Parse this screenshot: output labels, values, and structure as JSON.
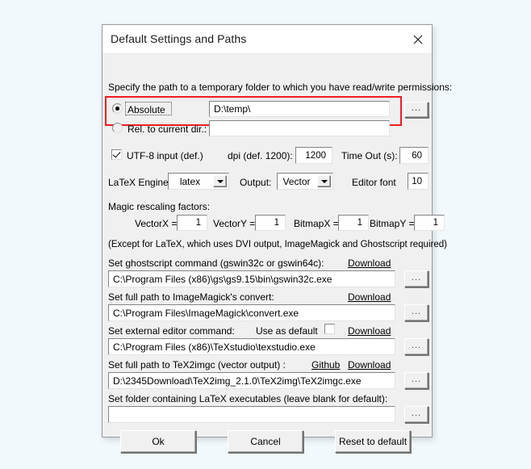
{
  "window": {
    "title": "Default Settings and Paths",
    "close_icon": "close-icon"
  },
  "temp_folder": {
    "instruction": "Specify the path to a temporary folder to which you have read/write permissions:",
    "absolute_label": "Absolute",
    "absolute_selected": true,
    "absolute_value": "D:\\temp\\",
    "absolute_browse": "...",
    "relative_label": "Rel. to current dir.: .\\",
    "relative_selected": false,
    "relative_value": "",
    "highlight_color": "#ee1c25"
  },
  "options": {
    "utf8_label": "UTF-8 input (def.)",
    "utf8_checked": true,
    "dpi_label": "dpi (def. 1200):",
    "dpi_value": "1200",
    "timeout_label": "Time Out (s):",
    "timeout_value": "60",
    "engine_label": "LaTeX Engine:",
    "engine_value": "latex",
    "engine_options": [
      "latex"
    ],
    "output_label": "Output:",
    "output_value": "Vector",
    "output_options": [
      "Vector"
    ],
    "editor_font_label": "Editor font",
    "editor_font_value": "10"
  },
  "rescaling": {
    "heading": "Magic rescaling factors:",
    "fields": [
      {
        "label": "VectorX =",
        "value": "1"
      },
      {
        "label": "VectorY =",
        "value": "1"
      },
      {
        "label": "BitmapX =",
        "value": "1"
      },
      {
        "label": "BitmapY =",
        "value": "1"
      }
    ],
    "note": "(Except for LaTeX, which uses DVI output, ImageMagick and Ghostscript required)"
  },
  "paths": {
    "ghostscript": {
      "label": "Set ghostscript command (gswin32c or gswin64c):",
      "download_link": "Download",
      "value": "C:\\Program Files (x86)\\gs\\gs9.15\\bin\\gswin32c.exe",
      "browse": "..."
    },
    "imagemagick": {
      "label": "Set full path to ImageMagick's convert:",
      "download_link": "Download",
      "value": "C:\\Program Files\\ImageMagick\\convert.exe",
      "browse": "..."
    },
    "editor": {
      "label": "Set external editor command:",
      "use_as_default_label": "Use as default",
      "use_as_default_checked": false,
      "download_link": "Download",
      "value": "C:\\Program Files (x86)\\TeXstudio\\texstudio.exe",
      "browse": "..."
    },
    "tex2imgc": {
      "label": "Set full path to TeX2imgc (vector output) :",
      "github_link": "Github",
      "download_link": "Download",
      "value": "D:\\2345Download\\TeX2img_2.1.0\\TeX2img\\TeX2imgc.exe",
      "browse": "..."
    },
    "latex_folder": {
      "label": "Set folder containing LaTeX executables (leave blank for default):",
      "value": "",
      "browse": "..."
    }
  },
  "buttons": {
    "ok": "Ok",
    "cancel": "Cancel",
    "reset": "Reset to default"
  }
}
